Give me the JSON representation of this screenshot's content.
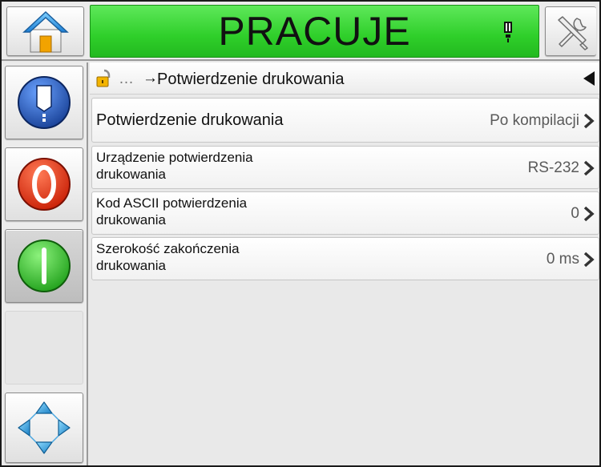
{
  "header": {
    "status_text": "PRACUJE",
    "status_color": "#2fcf2a",
    "home_icon": "home-icon",
    "tools_icon": "tools-icon",
    "status_icon": "printhead-icon"
  },
  "sidebar": {
    "buttons": [
      {
        "name": "info-button",
        "icon": "message-icon",
        "color": "#2255b5"
      },
      {
        "name": "stop-button",
        "icon": "stop-icon",
        "color": "#e02a12"
      },
      {
        "name": "start-button",
        "icon": "start-icon",
        "color": "#33c92c"
      },
      {
        "name": "navigate-button",
        "icon": "navigation-arrows-icon",
        "color": "#2a9fd6"
      }
    ]
  },
  "breadcrumb": {
    "lock_icon": "padlock-icon",
    "ellipsis": "…",
    "arrow": "→",
    "title": "Potwierdzenie drukowania",
    "back_icon": "back-arrow-icon"
  },
  "settings": [
    {
      "label": "Potwierdzenie drukowania",
      "value": "Po kompilacji"
    },
    {
      "label_line1": "Urządzenie potwierdzenia",
      "label_line2": "drukowania",
      "value": "RS-232"
    },
    {
      "label_line1": "Kod ASCII potwierdzenia",
      "label_line2": "drukowania",
      "value": "0"
    },
    {
      "label_line1": "Szerokość zakończenia",
      "label_line2": "drukowania",
      "value": "0 ms"
    }
  ]
}
